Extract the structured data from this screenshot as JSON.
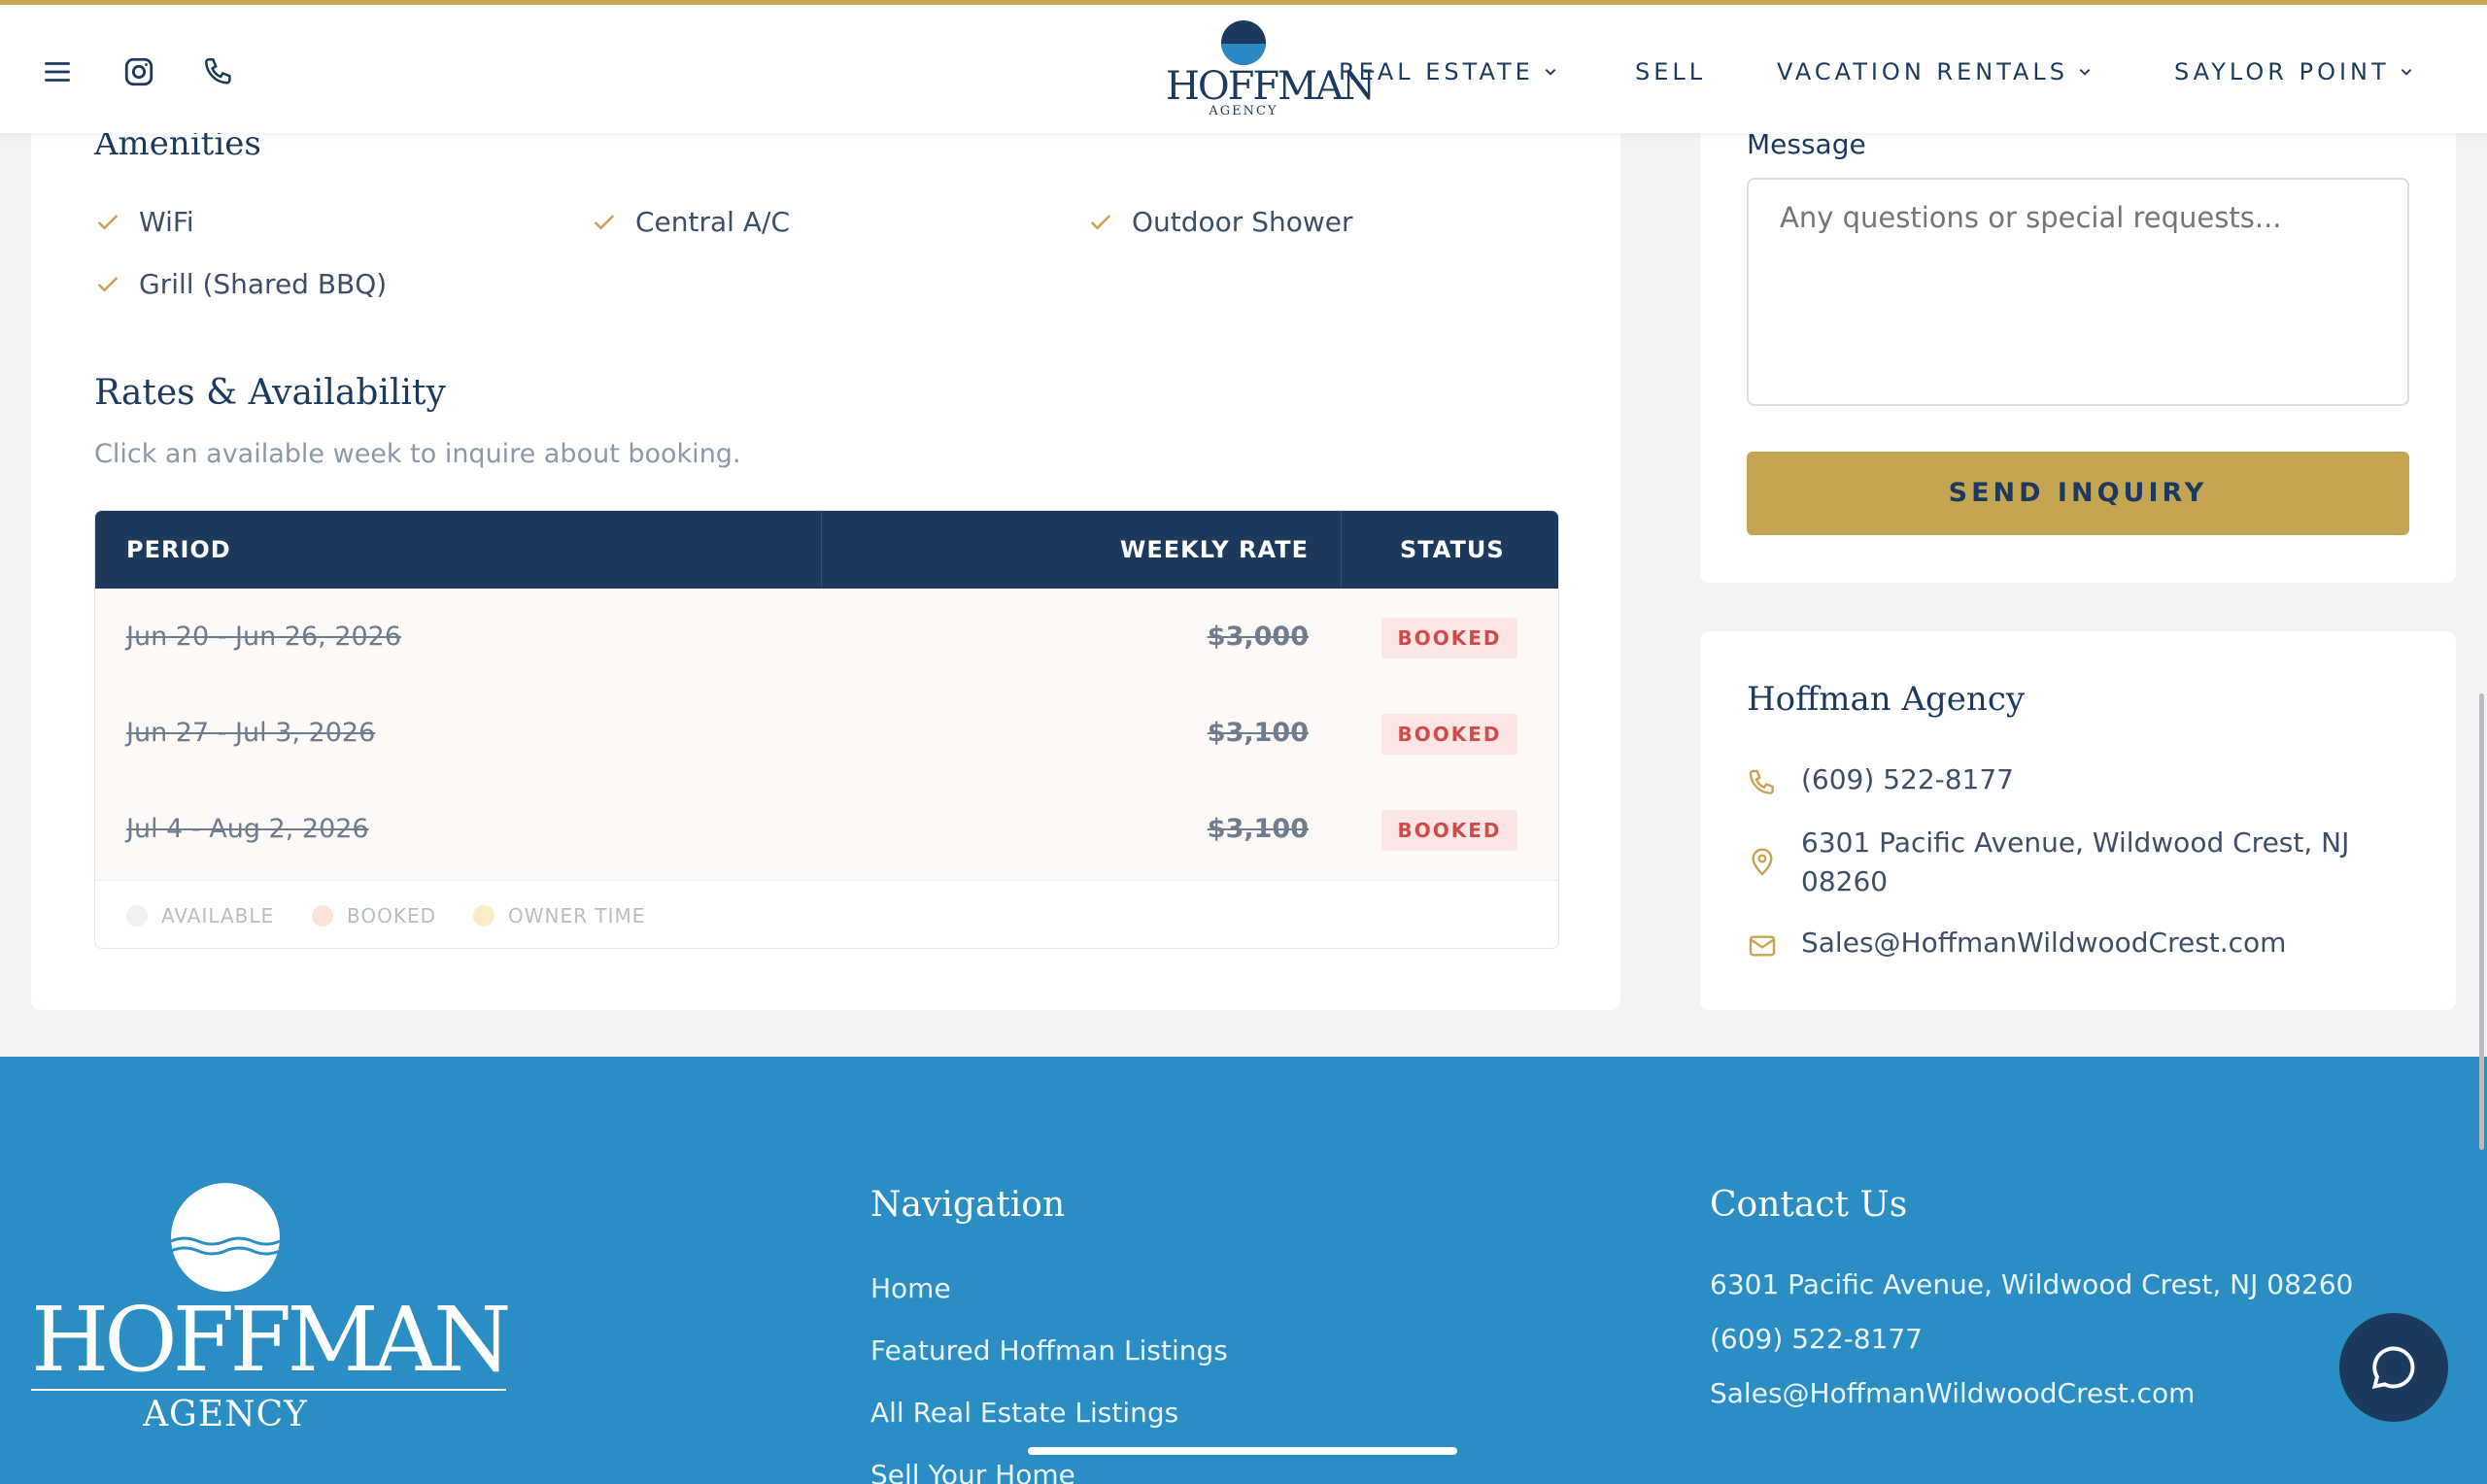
{
  "header": {
    "logo_word": "HOFFMAN",
    "logo_sub": "AGENCY",
    "nav": [
      {
        "label": "REAL ESTATE",
        "has_dropdown": true
      },
      {
        "label": "SELL",
        "has_dropdown": false
      },
      {
        "label": "VACATION RENTALS",
        "has_dropdown": true
      },
      {
        "label": "SAYLOR POINT",
        "has_dropdown": true
      }
    ]
  },
  "amenities": {
    "title": "Amenities",
    "items": [
      "WiFi",
      "Central A/C",
      "Outdoor Shower",
      "Grill (Shared BBQ)"
    ]
  },
  "rates": {
    "title": "Rates & Availability",
    "subtitle": "Click an available week to inquire about booking.",
    "columns": {
      "period": "PERIOD",
      "rate": "WEEKLY RATE",
      "status": "STATUS"
    },
    "rows": [
      {
        "period": "Jun 20 - Jun 26, 2026",
        "rate": "$3,000",
        "status": "BOOKED"
      },
      {
        "period": "Jun 27 - Jul 3, 2026",
        "rate": "$3,100",
        "status": "BOOKED"
      },
      {
        "period": "Jul 4 - Aug 2, 2026",
        "rate": "$3,100",
        "status": "BOOKED"
      }
    ],
    "legend": [
      {
        "label": "AVAILABLE",
        "color": "#eef0f2"
      },
      {
        "label": "BOOKED",
        "color": "#fbe3d6"
      },
      {
        "label": "OWNER TIME",
        "color": "#fbecc8"
      }
    ]
  },
  "form": {
    "message_label": "Message",
    "message_placeholder": "Any questions or special requests...",
    "submit_label": "SEND INQUIRY"
  },
  "agency": {
    "title": "Hoffman Agency",
    "phone": "(609) 522-8177",
    "address_line1": "6301 Pacific Avenue, Wildwood Crest, NJ",
    "address_line2": "08260",
    "email": "Sales@HoffmanWildwoodCrest.com"
  },
  "footer": {
    "logo_word": "HOFFMAN",
    "logo_sub": "AGENCY",
    "nav_title": "Navigation",
    "nav_links": [
      "Home",
      "Featured Hoffman Listings",
      "All Real Estate Listings",
      "Sell Your Home"
    ],
    "contact_title": "Contact Us",
    "contact_address": "6301 Pacific Avenue, Wildwood Crest, NJ 08260",
    "contact_phone": "(609) 522-8177",
    "contact_email": "Sales@HoffmanWildwoodCrest.com"
  },
  "colors": {
    "navy": "#1c3a5e",
    "gold": "#c5a452",
    "footer_blue": "#2a8dc3",
    "booked_red": "#d24a4a"
  },
  "icons": [
    "menu-icon",
    "instagram-icon",
    "phone-icon",
    "chevron-down-icon",
    "check-icon",
    "map-pin-icon",
    "mail-icon",
    "chat-bubble-icon"
  ]
}
